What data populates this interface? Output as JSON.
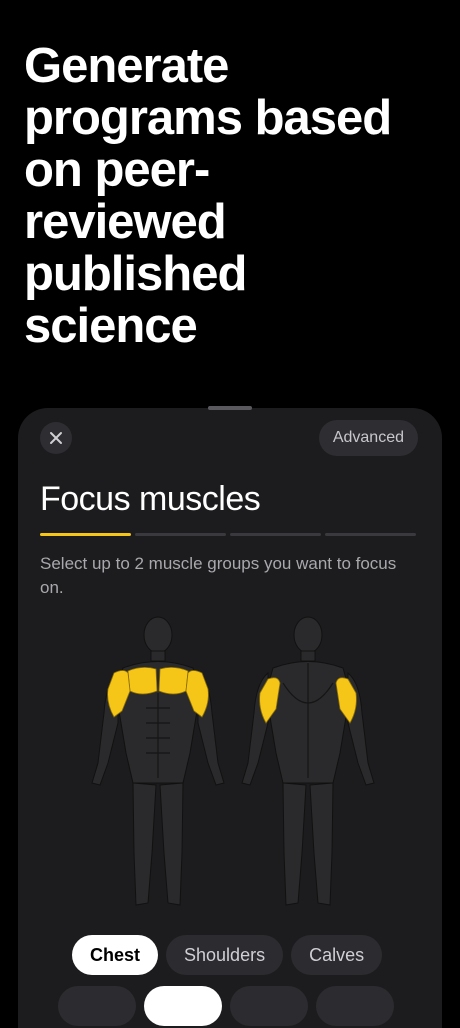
{
  "headline": "Generate\nprograms based\non peer-\nreviewed\npublished\nscience",
  "sheet": {
    "close_icon": "close-icon",
    "advanced_label": "Advanced",
    "title": "Focus muscles",
    "progress_steps": 4,
    "progress_active_step": 1,
    "subtitle": "Select up to 2 muscle groups you want to focus on.",
    "highlight_color": "#f5c518",
    "chips": [
      {
        "label": "Chest",
        "selected": true
      },
      {
        "label": "Shoulders",
        "selected": false
      },
      {
        "label": "Calves",
        "selected": false
      }
    ]
  }
}
